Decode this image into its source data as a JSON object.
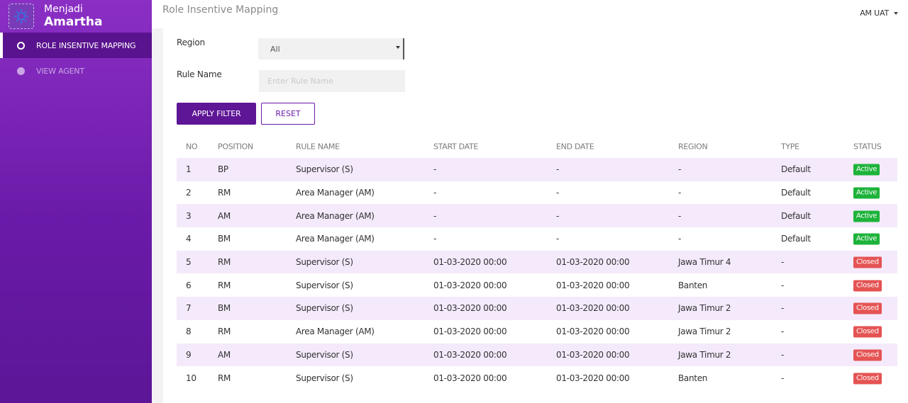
{
  "brand": {
    "line1": "Menjadi",
    "line2": "Amartha",
    "logo_icon": "sun-gear-icon"
  },
  "sidebar": {
    "items": [
      {
        "label": "ROLE INSENTIVE MAPPING",
        "icon": "user-circle-icon",
        "active": true
      },
      {
        "label": "VIEW AGENT",
        "icon": "agent-icon",
        "active": false
      }
    ]
  },
  "header": {
    "title": "Role Insentive Mapping",
    "user": "AM UAT"
  },
  "filters": {
    "region_label": "Region",
    "region_value": "All",
    "rule_label": "Rule Name",
    "rule_placeholder": "Enter Rule Name",
    "apply_label": "APPLY FILTER",
    "reset_label": "RESET"
  },
  "table": {
    "headers": [
      "NO",
      "POSITION",
      "RULE NAME",
      "START DATE",
      "END DATE",
      "REGION",
      "TYPE",
      "STATUS"
    ],
    "rows": [
      [
        "1",
        "BP",
        "Supervisor (S)",
        "-",
        "-",
        "-",
        "Default",
        "Active"
      ],
      [
        "2",
        "RM",
        "Area Manager (AM)",
        "-",
        "-",
        "-",
        "Default",
        "Active"
      ],
      [
        "3",
        "AM",
        "Area Manager (AM)",
        "-",
        "-",
        "-",
        "Default",
        "Active"
      ],
      [
        "4",
        "BM",
        "Area Manager (AM)",
        "-",
        "-",
        "-",
        "Default",
        "Active"
      ],
      [
        "5",
        "RM",
        "Supervisor (S)",
        "01-03-2020 00:00",
        "01-03-2020 00:00",
        "Jawa Timur 4",
        "-",
        "Closed"
      ],
      [
        "6",
        "RM",
        "Supervisor (S)",
        "01-03-2020 00:00",
        "01-03-2020 00:00",
        "Banten",
        "-",
        "Closed"
      ],
      [
        "7",
        "BM",
        "Supervisor (S)",
        "01-03-2020 00:00",
        "01-03-2020 00:00",
        "Jawa Timur 2",
        "-",
        "Closed"
      ],
      [
        "8",
        "RM",
        "Area Manager (AM)",
        "01-03-2020 00:00",
        "01-03-2020 00:00",
        "Jawa Timur 2",
        "-",
        "Closed"
      ],
      [
        "9",
        "AM",
        "Supervisor (S)",
        "01-03-2020 00:00",
        "01-03-2020 00:00",
        "Jawa Timur 2",
        "-",
        "Closed"
      ],
      [
        "10",
        "RM",
        "Supervisor (S)",
        "01-03-2020 00:00",
        "01-03-2020 00:00",
        "Banten",
        "-",
        "Closed"
      ]
    ]
  },
  "colors": {
    "sidebar": "#6a1aa8",
    "primary": "#5e1596",
    "active": "#1db33a",
    "closed": "#e55353",
    "row_alt": "#f4eafb"
  }
}
